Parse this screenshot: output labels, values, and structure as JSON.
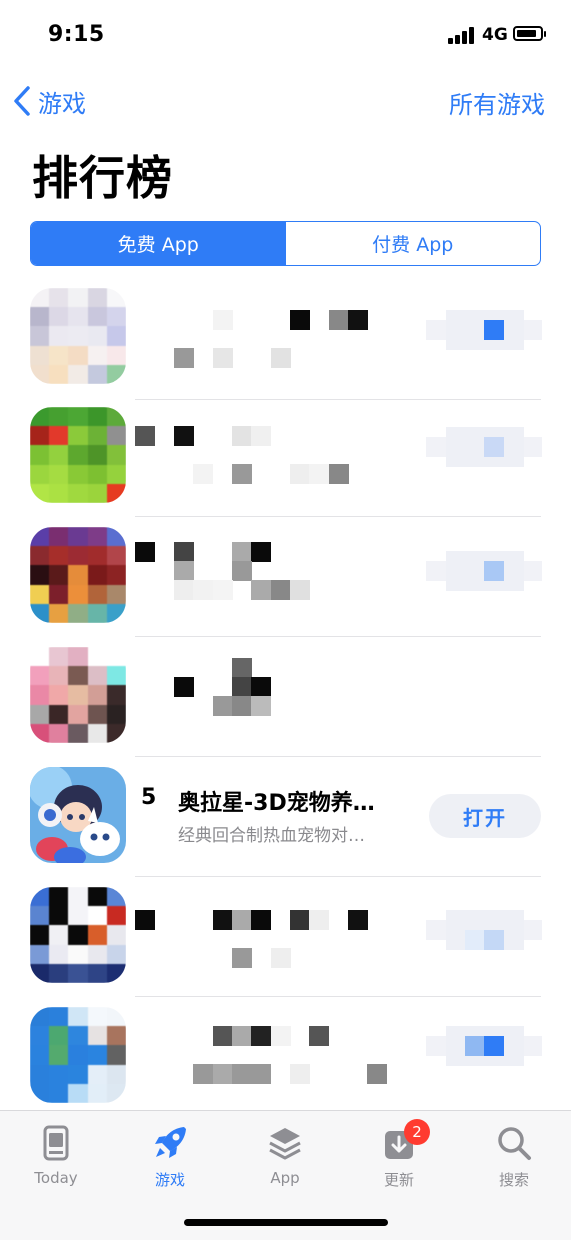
{
  "status_bar": {
    "time": "9:15",
    "network": "4G"
  },
  "nav": {
    "back_label": "游戏",
    "right_label": "所有游戏"
  },
  "page_title": "排行榜",
  "segments": [
    {
      "label": "免费 App",
      "selected": true
    },
    {
      "label": "付费 App",
      "selected": false
    }
  ],
  "focused_app": {
    "rank": "5",
    "name": "奥拉星-3D宠物养…",
    "subtitle": "经典回合制热血宠物对…",
    "action_label": "打开"
  },
  "tabs": [
    {
      "label": "Today",
      "icon": "today-icon"
    },
    {
      "label": "游戏",
      "icon": "rocket-icon",
      "active": true
    },
    {
      "label": "App",
      "icon": "layers-icon"
    },
    {
      "label": "更新",
      "icon": "download-icon",
      "badge": "2"
    },
    {
      "label": "搜索",
      "icon": "search-icon"
    }
  ],
  "colors": {
    "accent": "#2f7cf6",
    "badge": "#ff3b30"
  }
}
